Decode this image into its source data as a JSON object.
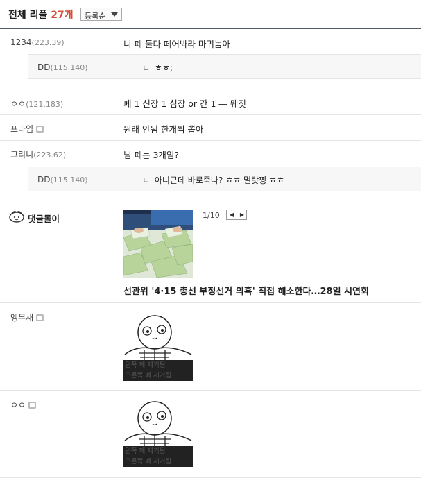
{
  "header": {
    "title": "전체 리플",
    "count": "27개",
    "sort_label": "등록순"
  },
  "comments": [
    {
      "nick": "1234",
      "ip": "(223.39)",
      "text": "니 폐 둘다 떼어봐라 마귀놈아"
    },
    {
      "nick": "DD",
      "ip": "(115.140)",
      "reply_mark": "ㄴ",
      "text": "ㅎㅎ;"
    },
    {
      "nick": "ㅇㅇ",
      "ip": "(121.183)",
      "text": "폐 1 신장 1 심장 or 간 1 ― 뭬짓"
    },
    {
      "nick": "프라임",
      "ip": "",
      "text": "원래 안됨 한개씩 뽑아"
    },
    {
      "nick": "그리니",
      "ip": "(223.62)",
      "text": "님 폐는 3개임?"
    },
    {
      "nick": "DD",
      "ip": "(115.140)",
      "reply_mark": "ㄴ",
      "text": "아니근데 바로죽나? ㅎㅎ 멀랏찡 ㅎㅎ"
    }
  ],
  "news_bot": {
    "name": "댓글돌이",
    "pager": "1/10",
    "prev_icon": "chevron-left-icon",
    "next_icon": "chevron-right-icon",
    "headline": "선관위 '4·15 총선 부정선거 의혹' 직접 해소한다…28일 시연회"
  },
  "image_comments": [
    {
      "nick": "앵무새",
      "caption_1": "왼쪽 폐      제거됨",
      "caption_2": "오른쪽 폐    제거됨"
    },
    {
      "nick": "ㅇㅇ",
      "caption_1": "왼쪽 폐      제거됨",
      "caption_2": "오른쪽 폐    제거됨"
    }
  ],
  "colors": {
    "count": "#d64d3a",
    "divider": "#555b6b",
    "reply_bg": "#f7f7f7"
  }
}
